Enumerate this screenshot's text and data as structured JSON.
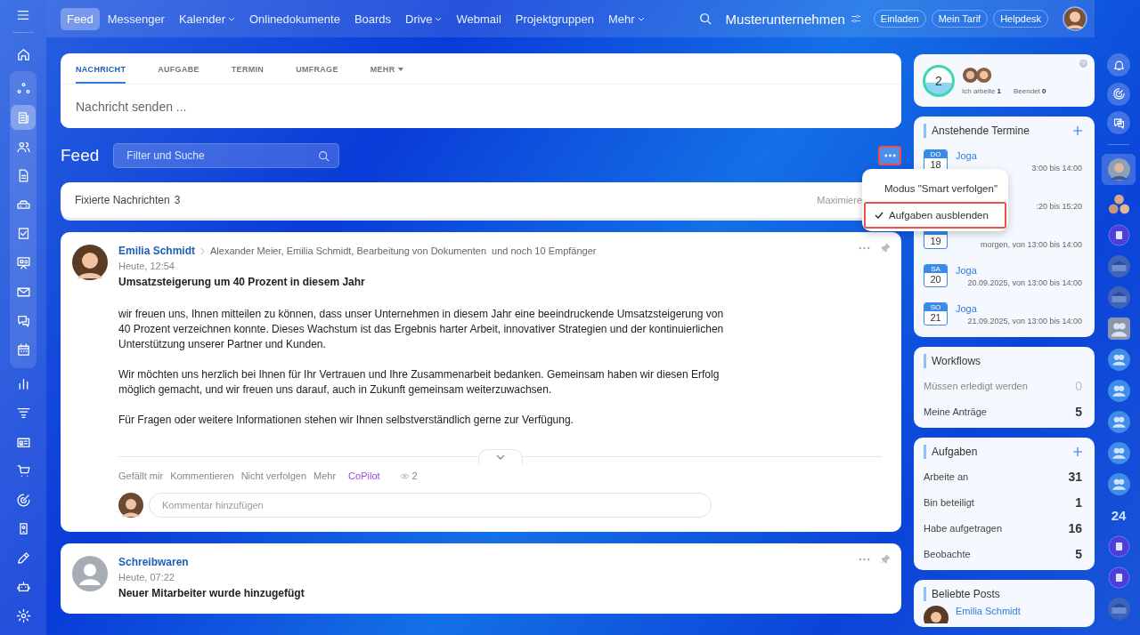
{
  "top_nav": {
    "items": [
      {
        "label": "Feed",
        "selected": true,
        "dropdown": false
      },
      {
        "label": "Messenger",
        "selected": false,
        "dropdown": false
      },
      {
        "label": "Kalender",
        "selected": false,
        "dropdown": true
      },
      {
        "label": "Onlinedokumente",
        "selected": false,
        "dropdown": false
      },
      {
        "label": "Boards",
        "selected": false,
        "dropdown": false
      },
      {
        "label": "Drive",
        "selected": false,
        "dropdown": true
      },
      {
        "label": "Webmail",
        "selected": false,
        "dropdown": false
      },
      {
        "label": "Projektgruppen",
        "selected": false,
        "dropdown": false
      },
      {
        "label": "Mehr",
        "selected": false,
        "dropdown": true
      }
    ],
    "company": "Musterunternehmen",
    "buttons": [
      "Einladen",
      "Mein Tarif",
      "Helpdesk"
    ]
  },
  "left_sidebar": {
    "top": [
      {
        "kind": "home",
        "selected": false
      }
    ],
    "group": [
      {
        "kind": "nodes",
        "selected": false
      },
      {
        "kind": "newspaper",
        "selected": true
      },
      {
        "kind": "people",
        "selected": false
      },
      {
        "kind": "document",
        "selected": false
      },
      {
        "kind": "drive",
        "selected": false
      },
      {
        "kind": "tasks",
        "selected": false
      },
      {
        "kind": "presentation",
        "selected": false
      },
      {
        "kind": "mail",
        "selected": false
      },
      {
        "kind": "chat",
        "selected": false
      },
      {
        "kind": "calendar",
        "selected": false
      }
    ],
    "bottom": [
      {
        "kind": "bar-chart",
        "selected": false
      },
      {
        "kind": "funnel",
        "selected": false
      },
      {
        "kind": "contact-card",
        "selected": false
      },
      {
        "kind": "cart",
        "selected": false
      },
      {
        "kind": "target",
        "selected": false
      },
      {
        "kind": "phone",
        "selected": false
      },
      {
        "kind": "pen",
        "selected": false
      },
      {
        "kind": "robot",
        "selected": false
      },
      {
        "kind": "gear",
        "selected": false
      }
    ]
  },
  "composer": {
    "tabs": [
      {
        "label": "NACHRICHT",
        "selected": true,
        "dropdown": false
      },
      {
        "label": "AUFGABE",
        "selected": false,
        "dropdown": false
      },
      {
        "label": "TERMIN",
        "selected": false,
        "dropdown": false
      },
      {
        "label": "UMFRAGE",
        "selected": false,
        "dropdown": false
      },
      {
        "label": "MEHR",
        "selected": false,
        "dropdown": true
      }
    ],
    "placeholder": "Nachricht senden ..."
  },
  "feed_header": {
    "title": "Feed",
    "search": {
      "placeholder": "Filter und Suche"
    },
    "more_highlighted": true
  },
  "feed_menu": {
    "items": [
      {
        "label": "Modus \"Smart verfolgen\"",
        "checked": false,
        "highlighted": false
      },
      {
        "label": "Aufgaben ausblenden",
        "checked": true,
        "highlighted": true
      }
    ]
  },
  "pinned": {
    "label": "Fixierte Nachrichten",
    "count": "3",
    "action": "Maximiere"
  },
  "posts": [
    {
      "avatar": {
        "kind": "photo"
      },
      "author": "Emilia Schmidt",
      "recipients": "Alexander Meier, Emilia Schmidt, Bearbeitung von Dokumenten",
      "more_recipients": "und noch 10 Empfänger",
      "time": "Heute, 12:54",
      "title": "Umsatzsteigerung um 40 Prozent in diesem Jahr",
      "paragraphs": [
        "wir freuen uns, Ihnen mitteilen zu können, dass unser Unternehmen in diesem Jahr eine beeindruckende Umsatzsteigerung von 40 Prozent verzeichnen konnte. Dieses Wachstum ist das Ergebnis harter Arbeit, innovativer Strategien und der kontinuierlichen Unterstützung unserer Partner und Kunden.",
        "Wir möchten uns herzlich bei Ihnen für Ihr Vertrauen und Ihre Zusammenarbeit bedanken. Gemeinsam haben wir diesen Erfolg möglich gemacht, und wir freuen uns darauf, auch in Zukunft gemeinsam weiterzuwachsen.",
        "Für Fragen oder weitere Informationen stehen wir Ihnen selbstverständlich gerne zur Verfügung."
      ],
      "actions": [
        "Gefällt mir",
        "Kommentieren",
        "Nicht verfolgen",
        "Mehr"
      ],
      "copilot": "CoPilot",
      "views": "2",
      "comment_placeholder": "Kommentar hinzufügen"
    },
    {
      "avatar": {
        "kind": "generic"
      },
      "author": "Schreibwaren",
      "time": "Heute, 07:22",
      "title": "Neuer Mitarbeiter wurde hinzugefügt"
    }
  ],
  "tasks_widget": {
    "counter": "2",
    "stats": [
      {
        "label": "Ich arbeite",
        "value": "1"
      },
      {
        "label": "Beendet",
        "value": "0"
      }
    ]
  },
  "events": {
    "title": "Anstehende Termine",
    "items": [
      {
        "weekday": "DO",
        "day": "18",
        "title": "Joga",
        "time": "3:00 bis 14:00"
      },
      {
        "time": ":20 bis 15:20"
      },
      {
        "day": "19",
        "time": "morgen, von 13:00 bis 14:00"
      },
      {
        "weekday": "SA",
        "day": "20",
        "title": "Joga",
        "time": "20.09.2025, von 13:00 bis 14:00"
      },
      {
        "weekday": "SO",
        "day": "21",
        "title": "Joga",
        "time": "21.09.2025, von 13:00 bis 14:00"
      }
    ]
  },
  "workflows": {
    "title": "Workflows",
    "rows": [
      {
        "label": "Müssen erledigt werden",
        "value": "0",
        "muted": true
      },
      {
        "label": "Meine Anträge",
        "value": "5",
        "muted": false
      }
    ]
  },
  "tasks": {
    "title": "Aufgaben",
    "rows": [
      {
        "label": "Arbeite an",
        "value": "31",
        "muted": false
      },
      {
        "label": "Bin beteiligt",
        "value": "1",
        "muted": false
      },
      {
        "label": "Habe aufgetragen",
        "value": "16",
        "muted": false
      },
      {
        "label": "Beobachte",
        "value": "5",
        "muted": false
      }
    ]
  },
  "popular_posts": {
    "title": "Beliebte Posts",
    "items": [
      {
        "author": "Emilia Schmidt"
      }
    ]
  },
  "right_rail": {
    "tools": [
      {
        "kind": "bell"
      },
      {
        "kind": "radar"
      },
      {
        "kind": "chat"
      }
    ],
    "chats": [
      {
        "kind": "person",
        "selected": true
      },
      {
        "kind": "group-photo",
        "selected": false
      },
      {
        "kind": "app",
        "selected": false
      },
      {
        "kind": "photo",
        "selected": false
      },
      {
        "kind": "photo",
        "selected": false
      },
      {
        "kind": "group-square",
        "selected": false
      },
      {
        "kind": "group",
        "selected": false
      },
      {
        "kind": "group",
        "selected": false
      },
      {
        "kind": "group",
        "selected": false
      },
      {
        "kind": "group",
        "selected": false
      },
      {
        "kind": "group",
        "selected": false
      },
      {
        "kind": "number",
        "label": "24",
        "selected": false
      },
      {
        "kind": "app",
        "selected": false
      },
      {
        "kind": "app",
        "selected": false
      },
      {
        "kind": "photo",
        "selected": false
      }
    ]
  }
}
